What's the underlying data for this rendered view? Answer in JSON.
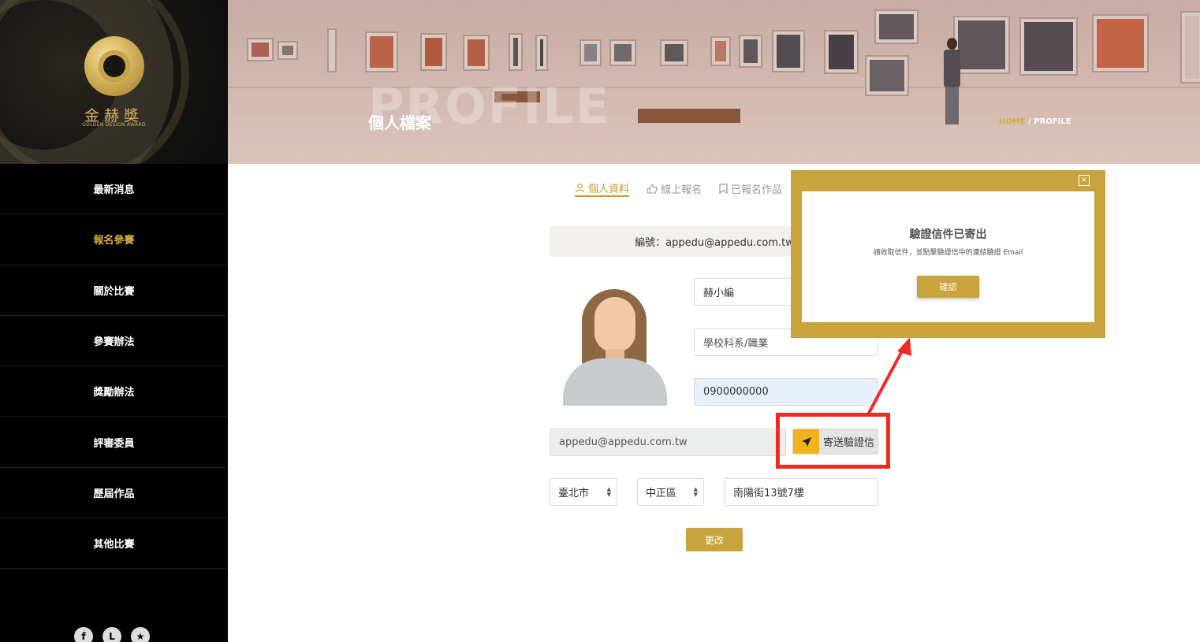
{
  "brand": {
    "name": "金赫獎",
    "subtitle": "GOLDEN DESIGN AWARD"
  },
  "sidebar": {
    "items": [
      {
        "label": "最新消息",
        "active": false
      },
      {
        "label": "報名參賽",
        "active": true
      },
      {
        "label": "關於比賽",
        "active": false
      },
      {
        "label": "參賽辦法",
        "active": false
      },
      {
        "label": "獎勵辦法",
        "active": false
      },
      {
        "label": "評審委員",
        "active": false
      },
      {
        "label": "歷屆作品",
        "active": false
      },
      {
        "label": "其他比賽",
        "active": false
      }
    ],
    "social": [
      {
        "icon": "facebook-icon",
        "glyph": "f"
      },
      {
        "icon": "line-icon",
        "glyph": "L"
      },
      {
        "icon": "star-icon",
        "glyph": "★"
      }
    ]
  },
  "banner": {
    "watermark": "PROFILE",
    "title": "個人檔案",
    "breadcrumb_home": "HOME",
    "breadcrumb_sep": " / ",
    "breadcrumb_current": "PROFILE"
  },
  "tabs": [
    {
      "label": "個人資料",
      "icon": "user-icon",
      "active": true
    },
    {
      "label": "線上報名",
      "icon": "thumbs-up-icon",
      "active": false
    },
    {
      "label": "已報名作品",
      "icon": "bookmark-icon",
      "active": false
    }
  ],
  "form": {
    "id_text": "編號：appedu@appedu.com.tw",
    "name_value": "赫小編",
    "department_placeholder": "學校科系/職業",
    "phone_value": "0900000000",
    "email_value": "appedu@appedu.com.tw",
    "send_verify_label": "寄送驗證信",
    "city_value": "臺北市",
    "district_value": "中正區",
    "address_value": "南陽街13號7樓",
    "submit_label": "更改"
  },
  "modal": {
    "close_glyph": "×",
    "title": "驗證信件已寄出",
    "message": "請收取信件，並點擊驗證信中的連結驗證 Email",
    "confirm_label": "確認"
  },
  "colors": {
    "accent_gold": "#c9a43e",
    "highlight_red": "#ef2b23",
    "send_icon_yellow": "#f2b21b"
  }
}
